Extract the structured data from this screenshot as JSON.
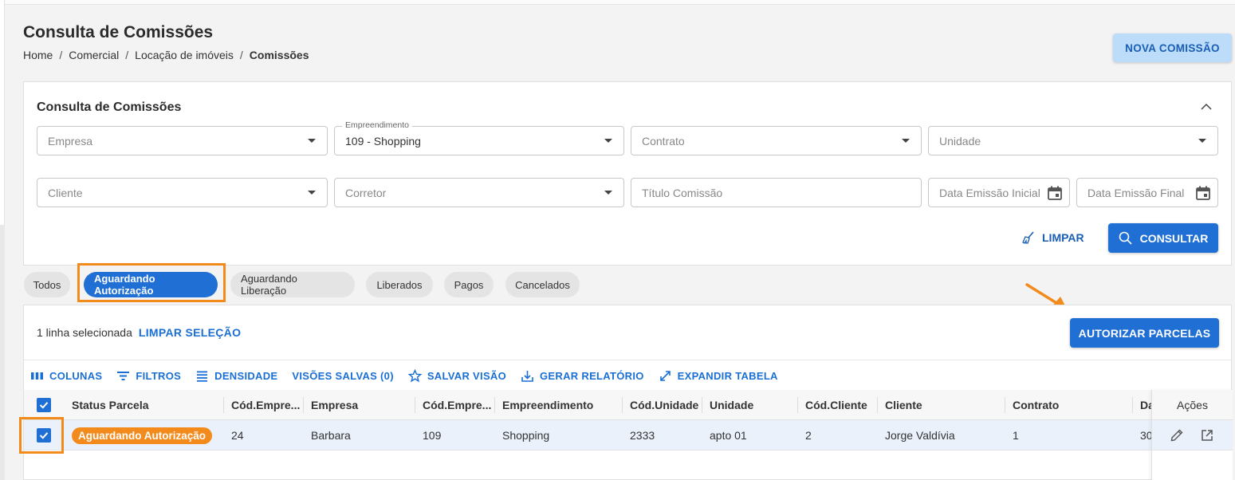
{
  "page": {
    "title": "Consulta de Comissões",
    "breadcrumb": [
      "Home",
      "Comercial",
      "Locação de imóveis",
      "Comissões"
    ],
    "breadcrumb_sep": "/",
    "new_button": "NOVA COMISSÃO"
  },
  "filters": {
    "title": "Consulta de Comissões",
    "empresa_placeholder": "Empresa",
    "empreendimento_label": "Empreendimento",
    "empreendimento_value": "109 - Shopping",
    "contrato_placeholder": "Contrato",
    "unidade_placeholder": "Unidade",
    "cliente_placeholder": "Cliente",
    "corretor_placeholder": "Corretor",
    "titulo_placeholder": "Título Comissão",
    "data_inicial_placeholder": "Data Emissão Inicial",
    "data_final_placeholder": "Data Emissão Final",
    "clear_button": "LIMPAR",
    "search_button": "CONSULTAR"
  },
  "tabs": {
    "todos": "Todos",
    "aguardando_autorizacao": "Aguardando Autorização",
    "aguardando_liberacao": "Aguardando Liberação",
    "liberados": "Liberados",
    "pagos": "Pagos",
    "cancelados": "Cancelados",
    "active": "aguardando_autorizacao"
  },
  "grid": {
    "selection_text": "1 linha selecionada",
    "clear_selection": "LIMPAR SELEÇÃO",
    "authorize_button": "AUTORIZAR PARCELAS",
    "toolbar": {
      "colunas": "COLUNAS",
      "filtros": "FILTROS",
      "densidade": "DENSIDADE",
      "visoes": "VISÕES SALVAS (0)",
      "salvar": "SALVAR VISÃO",
      "relatorio": "GERAR RELATÓRIO",
      "expandir": "EXPANDIR TABELA"
    },
    "columns": {
      "status": "Status Parcela",
      "cod_empresa": "Cód.Empre...",
      "empresa": "Empresa",
      "cod_empreend": "Cód.Empre...",
      "empreendimento": "Empreendimento",
      "cod_unidade": "Cód.Unidade",
      "unidade": "Unidade",
      "cod_cliente": "Cód.Cliente",
      "cliente": "Cliente",
      "contrato": "Contrato",
      "data": "Da",
      "acoes": "Ações"
    },
    "row": {
      "status": "Aguardando Autorização",
      "cod_empresa": "24",
      "empresa": "Barbara",
      "cod_empreend": "109",
      "empreendimento": "Shopping",
      "cod_unidade": "2333",
      "unidade": "apto 01",
      "cod_cliente": "2",
      "cliente": "Jorge Valdívia",
      "contrato": "1",
      "data": "30"
    }
  },
  "colors": {
    "primary": "#1f6fd4",
    "accent_orange": "#f28a1c",
    "light_primary": "#bcdcf9"
  }
}
